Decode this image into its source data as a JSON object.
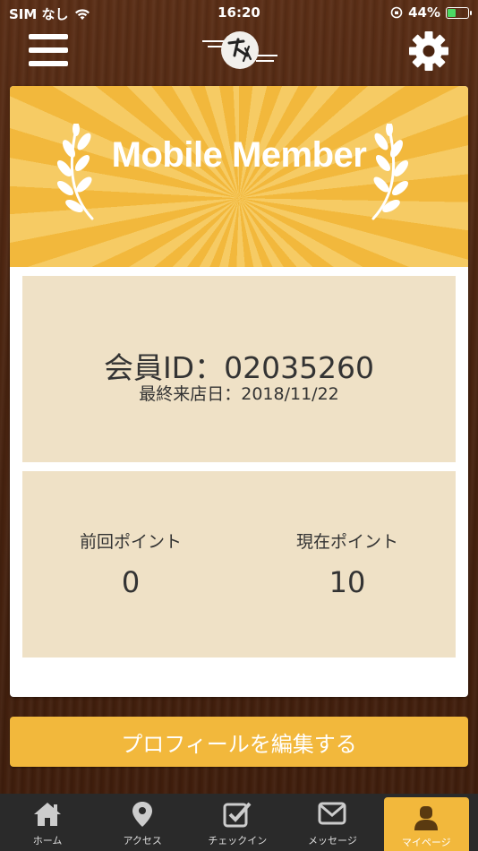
{
  "status_bar": {
    "carrier": "SIM なし",
    "time": "16:20",
    "battery": "44%",
    "battery_level": 0.44
  },
  "header": {
    "menu_icon": "hamburger-menu-icon",
    "logo_icon": "restaurant-logo",
    "settings_icon": "gear-icon"
  },
  "banner": {
    "title": "Mobile Member"
  },
  "member": {
    "id_text": "会員ID：02035260",
    "last_visit_text": "最終来店日：2018/11/22"
  },
  "points": {
    "previous_label": "前回ポイント",
    "previous_value": "0",
    "current_label": "現在ポイント",
    "current_value": "10"
  },
  "edit_profile_label": "プロフィールを編集する",
  "tabs": [
    {
      "label": "ホーム",
      "icon": "home-icon"
    },
    {
      "label": "アクセス",
      "icon": "map-pin-icon"
    },
    {
      "label": "チェックイン",
      "icon": "checkbox-icon"
    },
    {
      "label": "メッセージ",
      "icon": "envelope-icon"
    },
    {
      "label": "マイページ",
      "icon": "user-icon"
    }
  ],
  "colors": {
    "accent": "#f2b83c",
    "panel": "#efe1c6",
    "tabbar": "#2a2a2a"
  }
}
